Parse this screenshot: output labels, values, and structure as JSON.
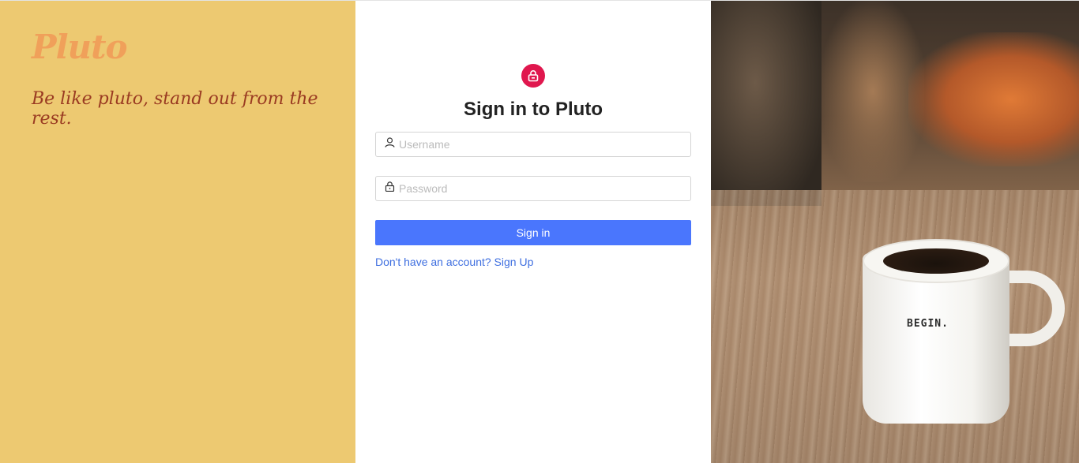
{
  "brand": {
    "title": "Pluto",
    "tagline": "Be like pluto, stand out from the rest.",
    "background": "#edc971",
    "title_color": "#f0a05a",
    "tagline_color": "#9a3b22"
  },
  "form": {
    "lock_icon": "lock-icon",
    "lock_color": "#e0174e",
    "title": "Sign in to Pluto",
    "username": {
      "icon": "user-icon",
      "placeholder": "Username",
      "value": ""
    },
    "password": {
      "icon": "lock-icon",
      "placeholder": "Password",
      "value": ""
    },
    "submit_label": "Sign in",
    "submit_color": "#4a76fd",
    "signup_link": "Don't have an account? Sign Up"
  },
  "photo": {
    "mug_text": "BEGIN."
  }
}
